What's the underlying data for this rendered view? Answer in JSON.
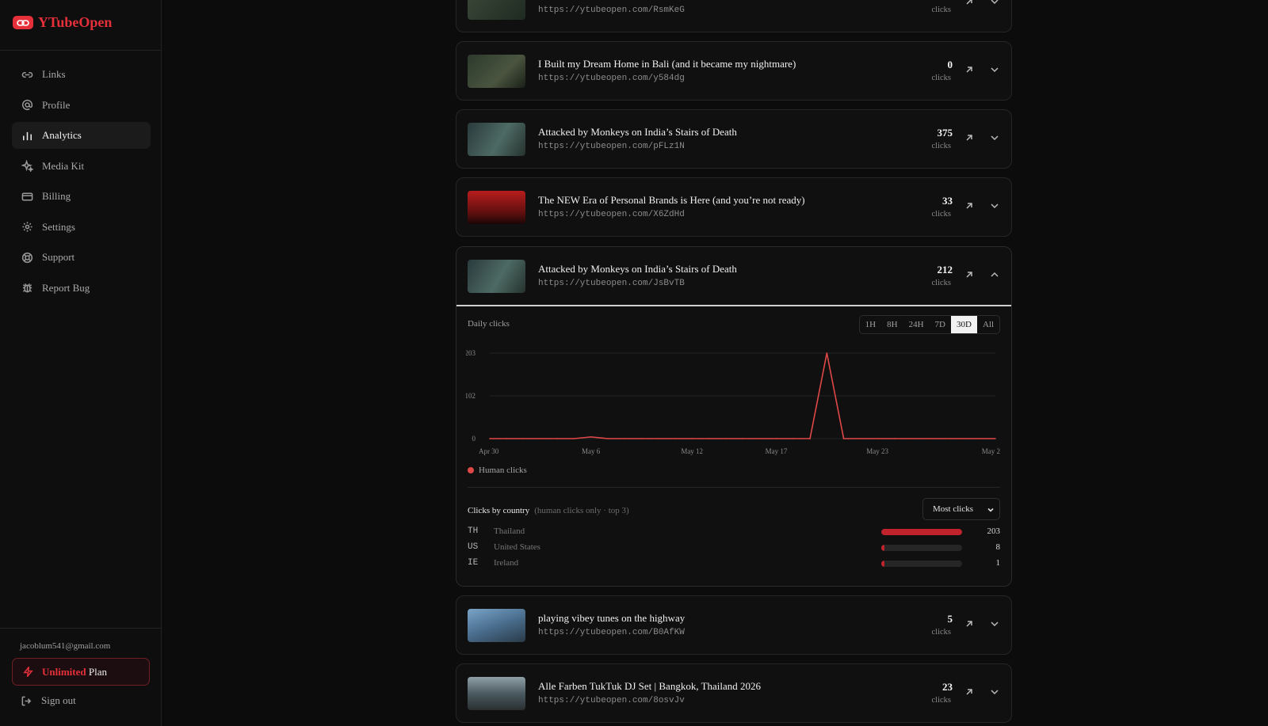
{
  "app": {
    "name": "YTubeOpen",
    "brand_color": "#e5303a"
  },
  "nav": [
    {
      "label": "Links",
      "icon": "link-icon",
      "active": false
    },
    {
      "label": "Profile",
      "icon": "at-icon",
      "active": false
    },
    {
      "label": "Analytics",
      "icon": "bar-chart-icon",
      "active": true
    },
    {
      "label": "Media Kit",
      "icon": "sparkle-icon",
      "active": false
    },
    {
      "label": "Billing",
      "icon": "card-icon",
      "active": false
    },
    {
      "label": "Settings",
      "icon": "gear-icon",
      "active": false
    },
    {
      "label": "Support",
      "icon": "lifebuoy-icon",
      "active": false
    },
    {
      "label": "Report Bug",
      "icon": "bug-icon",
      "active": false
    }
  ],
  "account": {
    "email": "jacoblum541@gmail.com",
    "plan_highlight": "Unlimited",
    "plan_suffix": "Plan",
    "signout": "Sign out"
  },
  "clicks_label": "clicks",
  "links": [
    {
      "title": "",
      "url": "https://ytubeopen.com/RsmKeG",
      "clicks": "",
      "expanded": false
    },
    {
      "title": "I Built my Dream Home in Bali (and it became my nightmare)",
      "url": "https://ytubeopen.com/y584dg",
      "clicks": "0",
      "expanded": false
    },
    {
      "title": "Attacked by Monkeys on India’s Stairs of Death",
      "url": "https://ytubeopen.com/pFLz1N",
      "clicks": "375",
      "expanded": false
    },
    {
      "title": "The NEW Era of Personal Brands is Here (and you’re not ready)",
      "url": "https://ytubeopen.com/X6ZdHd",
      "clicks": "33",
      "expanded": false
    },
    {
      "title": "Attacked by Monkeys on India’s Stairs of Death",
      "url": "https://ytubeopen.com/JsBvTB",
      "clicks": "212",
      "expanded": true
    },
    {
      "title": "playing vibey tunes on the highway",
      "url": "https://ytubeopen.com/B0AfKW",
      "clicks": "5",
      "expanded": false
    },
    {
      "title": "Alle Farben TukTuk DJ Set | Bangkok, Thailand 2026",
      "url": "https://ytubeopen.com/8osvJv",
      "clicks": "23",
      "expanded": false
    }
  ],
  "detail": {
    "daily_label": "Daily clicks",
    "ranges": [
      "1H",
      "8H",
      "24H",
      "7D",
      "30D",
      "All"
    ],
    "active_range": "30D",
    "legend": "Human clicks",
    "country_title": "Clicks by country",
    "country_sub": "(human clicks only · top 3)",
    "sort_label": "Most clicks",
    "countries": [
      {
        "code": "TH",
        "name": "Thailand",
        "clicks": 203
      },
      {
        "code": "US",
        "name": "United States",
        "clicks": 8
      },
      {
        "code": "IE",
        "name": "Ireland",
        "clicks": 1
      }
    ]
  },
  "chart_data": {
    "type": "line",
    "title": "Daily clicks",
    "x_tick_labels": [
      "Apr 30",
      "May 6",
      "May 12",
      "May 17",
      "May 23",
      "May 2"
    ],
    "y_tick_labels": [
      "203",
      "102",
      "0"
    ],
    "ylim": [
      0,
      203
    ],
    "grid": true,
    "legend_position": "bottom-left",
    "series": [
      {
        "name": "Human clicks",
        "color": "#e04848",
        "x": [
          "Apr 30",
          "May 1",
          "May 2",
          "May 3",
          "May 4",
          "May 5",
          "May 6",
          "May 7",
          "May 8",
          "May 9",
          "May 10",
          "May 11",
          "May 12",
          "May 13",
          "May 14",
          "May 15",
          "May 16",
          "May 17",
          "May 18",
          "May 19",
          "May 20",
          "May 21",
          "May 22",
          "May 23",
          "May 24",
          "May 25",
          "May 26",
          "May 27",
          "May 28",
          "May 29",
          "May 30"
        ],
        "values": [
          0,
          0,
          0,
          0,
          0,
          0,
          4,
          0,
          0,
          0,
          0,
          0,
          0,
          0,
          0,
          0,
          0,
          0,
          0,
          0,
          203,
          0,
          0,
          0,
          0,
          0,
          0,
          0,
          0,
          0,
          0
        ]
      }
    ]
  }
}
